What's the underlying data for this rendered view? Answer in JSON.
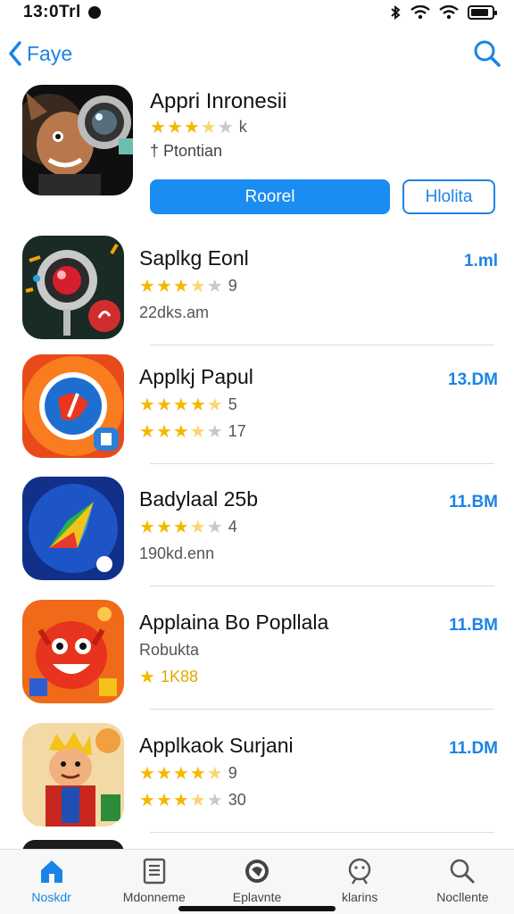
{
  "status_bar": {
    "time": "13:0Trl"
  },
  "nav": {
    "back_label": "Faye"
  },
  "featured": {
    "title": "Appri Inronesii",
    "rating_text": "k",
    "rating": 3.5,
    "subtitle": "† Ptontian",
    "primary_button": "Roorel",
    "secondary_button": "Hlolita"
  },
  "apps": [
    {
      "name": "Saplkg Eonl",
      "size": "1.ml",
      "stars1": 3.5,
      "line1_text": "9",
      "line2_text": "22dks.am",
      "icon": "camera-lens-icon"
    },
    {
      "name": "Applkj Papul",
      "size": "13.DM",
      "stars1": 4.5,
      "line1_text": "5",
      "stars2": 3.5,
      "line2_text": "17",
      "icon": "compass-game-icon"
    },
    {
      "name": "Badylaal 25b",
      "size": "11.BM",
      "stars1": 3.5,
      "line1_text": "4",
      "line2_text": "190kd.enn",
      "icon": "play-triangle-icon"
    },
    {
      "name": "Applaina Bo Popllala",
      "size": "11.BM",
      "line1_text": "Robukta",
      "line2_text": "1K88",
      "line2_stars": 1,
      "icon": "red-monster-icon"
    },
    {
      "name": "Applkaok Surjani",
      "size": "11.DM",
      "stars1": 4.5,
      "line1_text": "9",
      "stars2": 3.5,
      "line2_text": "30",
      "icon": "king-character-icon"
    }
  ],
  "tabs": [
    {
      "label": "Noskdr",
      "icon": "home-icon",
      "active": true
    },
    {
      "label": "Mdonneme",
      "icon": "document-icon",
      "active": false
    },
    {
      "label": "Eplavnte",
      "icon": "globe-icon",
      "active": false
    },
    {
      "label": "klarins",
      "icon": "face-icon",
      "active": false
    },
    {
      "label": "Nocllente",
      "icon": "search-icon",
      "active": false
    }
  ]
}
